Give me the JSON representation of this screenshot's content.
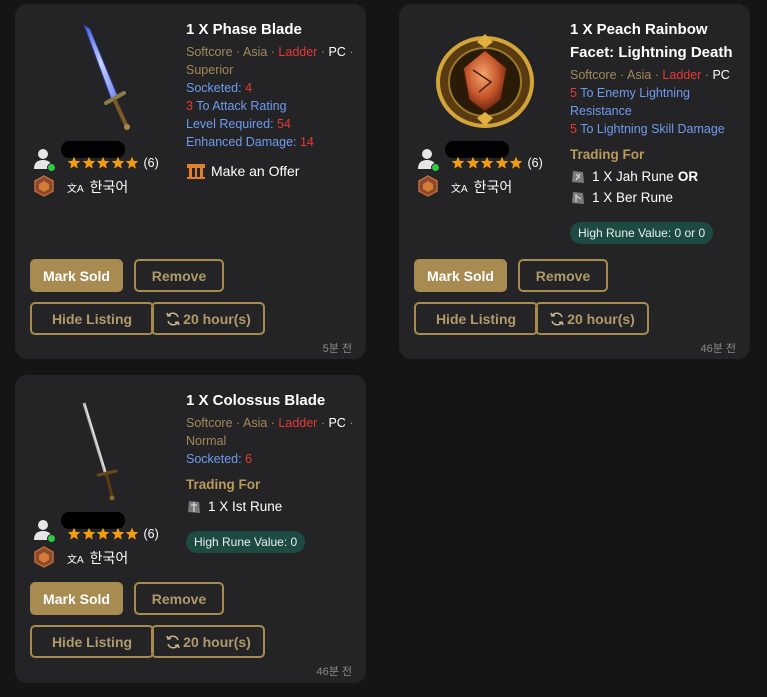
{
  "cards": [
    {
      "title": "1 X Phase Blade",
      "softcore": "Softcore",
      "region": "Asia",
      "ladder": "Ladder",
      "platform": "PC",
      "quality": "Superior",
      "props": [
        {
          "label": "Socketed:",
          "value": "4"
        },
        {
          "lead": "3",
          "label": "To Attack Rating"
        },
        {
          "label": "Level Required:",
          "value": "54"
        },
        {
          "label": "Enhanced Damage:",
          "value": "14"
        }
      ],
      "offer_label": "Make an Offer",
      "rating_count": "(6)",
      "language": "한국어",
      "mark_sold": "Mark Sold",
      "remove": "Remove",
      "hide_listing": "Hide Listing",
      "duration": "20 hour(s)",
      "time_ago": "5분 전"
    },
    {
      "title": "1 X Peach Rainbow Facet: Lightning Death",
      "softcore": "Softcore",
      "region": "Asia",
      "ladder": "Ladder",
      "platform": "PC",
      "props": [
        {
          "lead": "5",
          "label": "To Enemy Lightning Resistance"
        },
        {
          "lead": "5",
          "label": "To Lightning Skill Damage"
        }
      ],
      "trading_for": "Trading For",
      "runes": [
        {
          "text": "1 X Jah Rune",
          "or": "OR"
        },
        {
          "text": "1 X Ber Rune"
        }
      ],
      "high_rune_value": "High Rune Value: 0 or 0",
      "rating_count": "(6)",
      "language": "한국어",
      "mark_sold": "Mark Sold",
      "remove": "Remove",
      "hide_listing": "Hide Listing",
      "duration": "20 hour(s)",
      "time_ago": "46분 전"
    },
    {
      "title": "1 X Colossus Blade",
      "softcore": "Softcore",
      "region": "Asia",
      "ladder": "Ladder",
      "platform": "PC",
      "quality": "Normal",
      "props": [
        {
          "label": "Socketed:",
          "value": "6"
        }
      ],
      "trading_for": "Trading For",
      "runes": [
        {
          "text": "1 X Ist Rune"
        }
      ],
      "high_rune_value": "High Rune Value: 0",
      "rating_count": "(6)",
      "language": "한국어",
      "mark_sold": "Mark Sold",
      "remove": "Remove",
      "hide_listing": "Hide Listing",
      "duration": "20 hour(s)",
      "time_ago": "46분 전"
    }
  ],
  "colors": {
    "accent": "#a78b50",
    "ladder_red": "#e53935",
    "prop_blue": "#6f9bef",
    "card_bg": "#242426",
    "page_bg": "#151516",
    "hrv_bg": "#1d4a42",
    "online_green": "#2ecc40",
    "star_orange": "#f39c12"
  },
  "icons": {
    "user": "user-icon",
    "online": "online-dot",
    "star": "star-icon",
    "badge": "trade-badge-icon",
    "language": "language-icon",
    "offer": "offer-icon",
    "rune": "rune-icon",
    "sync": "sync-icon"
  }
}
